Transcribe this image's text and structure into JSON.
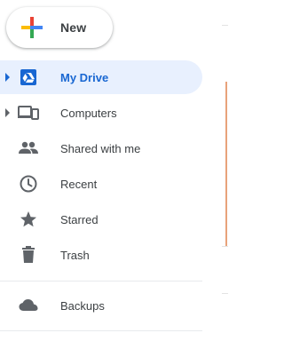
{
  "new_button": {
    "label": "New",
    "icon": "multicolor-plus-icon"
  },
  "nav": {
    "items": [
      {
        "label": "My Drive",
        "icon": "drive-icon",
        "active": true,
        "expandable": true
      },
      {
        "label": "Computers",
        "icon": "computers-icon",
        "active": false,
        "expandable": true
      },
      {
        "label": "Shared with me",
        "icon": "people-icon",
        "active": false,
        "expandable": false
      },
      {
        "label": "Recent",
        "icon": "clock-icon",
        "active": false,
        "expandable": false
      },
      {
        "label": "Starred",
        "icon": "star-icon",
        "active": false,
        "expandable": false
      },
      {
        "label": "Trash",
        "icon": "trash-icon",
        "active": false,
        "expandable": false
      }
    ],
    "secondary": [
      {
        "label": "Backups",
        "icon": "cloud-icon"
      }
    ]
  },
  "colors": {
    "active_bg": "#e8f0fe",
    "active_text": "#1967d2",
    "icon_gray": "#5f6368",
    "text": "#3c4043",
    "plus_blue": "#4285f4",
    "plus_red": "#ea4335",
    "plus_yellow": "#fbbc04",
    "plus_green": "#34a853"
  }
}
